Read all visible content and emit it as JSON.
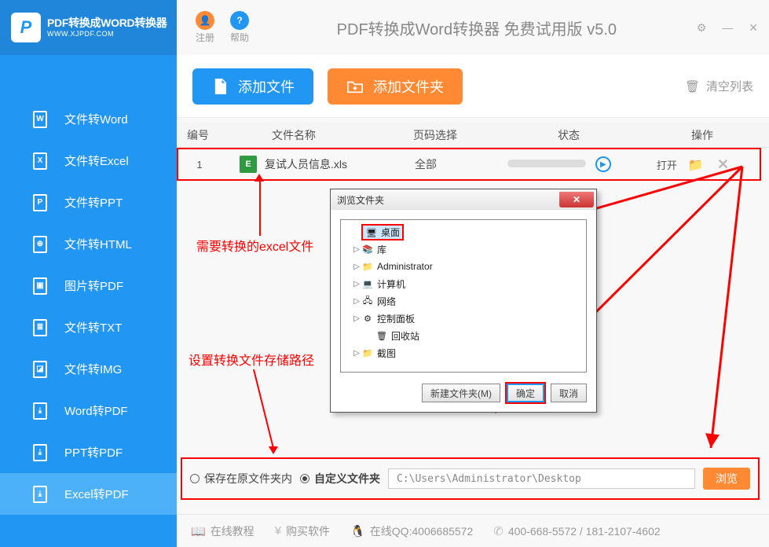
{
  "brand": {
    "title": "PDF转换成WORD转换器",
    "sub": "WWW.XJPDF.COM",
    "logo_letter": "P"
  },
  "topbar": {
    "register": "注册",
    "help": "帮助",
    "title": "PDF转换成Word转换器 免费试用版 v5.0"
  },
  "nav": {
    "items": [
      {
        "label": "文件转Word",
        "glyph": "W"
      },
      {
        "label": "文件转Excel",
        "glyph": "X"
      },
      {
        "label": "文件转PPT",
        "glyph": "P"
      },
      {
        "label": "文件转HTML",
        "glyph": "⊕"
      },
      {
        "label": "图片转PDF",
        "glyph": "▣"
      },
      {
        "label": "文件转TXT",
        "glyph": "≣"
      },
      {
        "label": "文件转IMG",
        "glyph": "◪"
      },
      {
        "label": "Word转PDF",
        "glyph": "⤓"
      },
      {
        "label": "PPT转PDF",
        "glyph": "⤓"
      },
      {
        "label": "Excel转PDF",
        "glyph": "⤓"
      }
    ]
  },
  "toolbar": {
    "add_file": "添加文件",
    "add_folder": "添加文件夹",
    "clear_list": "清空列表"
  },
  "table": {
    "headers": {
      "id": "编号",
      "name": "文件名称",
      "page": "页码选择",
      "status": "状态",
      "op": "操作"
    },
    "rows": [
      {
        "id": "1",
        "name": "复试人员信息.xls",
        "page": "全部",
        "open": "打开"
      }
    ]
  },
  "annotations": {
    "file_hint": "需要转换的excel文件",
    "path_hint": "设置转换文件存储路径"
  },
  "dialog": {
    "title": "浏览文件夹",
    "tree": {
      "desktop": "桌面",
      "library": "库",
      "admin": "Administrator",
      "computer": "计算机",
      "network": "网络",
      "control": "控制面板",
      "recycle": "回收站",
      "screenshot": "截图"
    },
    "new_folder": "新建文件夹(M)",
    "ok": "确定",
    "cancel": "取消"
  },
  "output": {
    "save_same": "保存在原文件夹内",
    "save_custom": "自定义文件夹",
    "path": "C:\\Users\\Administrator\\Desktop",
    "browse": "浏览"
  },
  "footer": {
    "tutorial": "在线教程",
    "buy": "购买软件",
    "qq_label": "在线QQ:4006685572",
    "phone": "400-668-5572 / 181-2107-4602"
  }
}
